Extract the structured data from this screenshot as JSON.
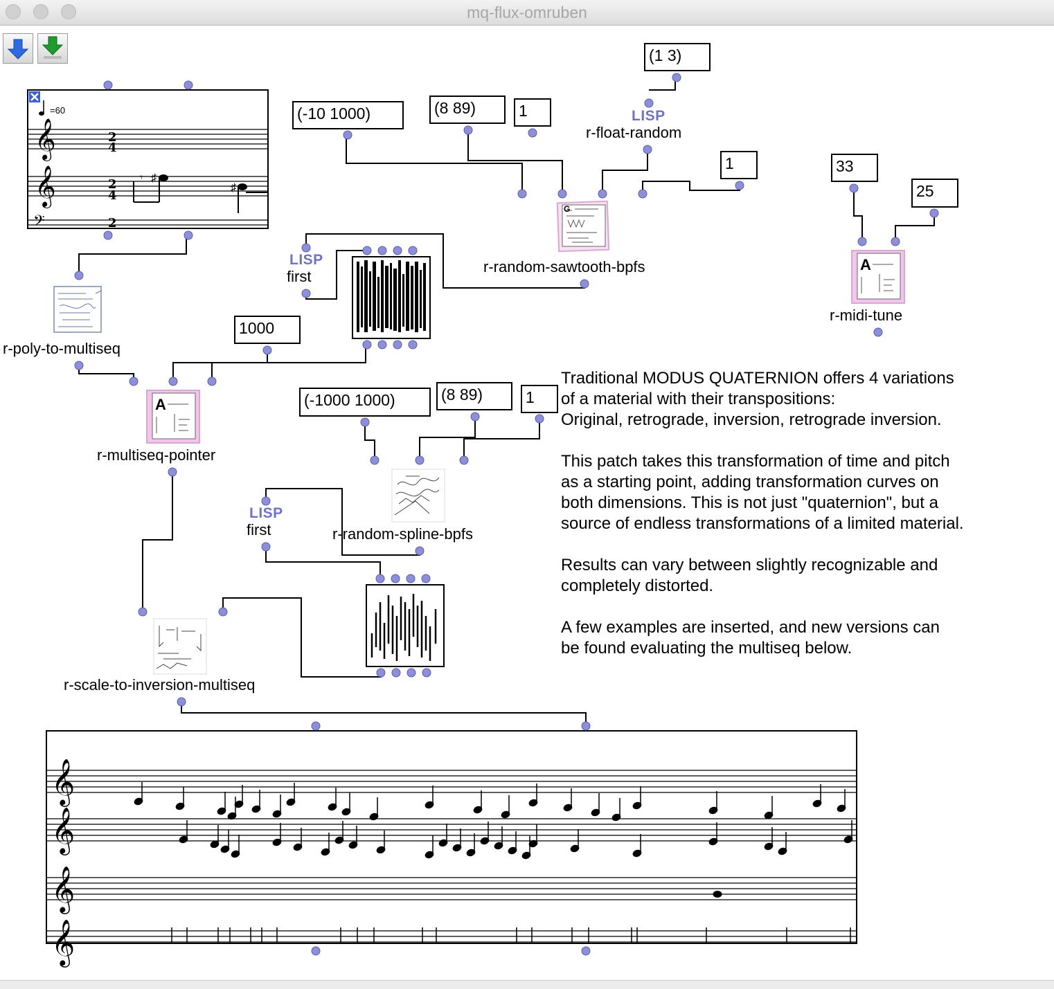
{
  "window": {
    "title": "mq-flux-omruben"
  },
  "toolbar": {
    "buttons": [
      {
        "icon": "blue-down-arrow-icon"
      },
      {
        "icon": "green-down-arrow-icon"
      }
    ]
  },
  "value_boxes": {
    "pair_1_3": "(1 3)",
    "range_10_1000": "(-10 1000)",
    "range_8_89_top": "(8 89)",
    "one_top": "1",
    "one_right": "1",
    "num_33": "33",
    "num_25": "25",
    "num_1000": "1000",
    "range_1000_1000": "(-1000 1000)",
    "range_8_89_mid": "(8 89)",
    "one_mid": "1"
  },
  "lisp_tag": "LISP",
  "labels": {
    "float_random": "r-float-random",
    "sawtooth": "r-random-sawtooth-bpfs",
    "midi_tune": "r-midi-tune",
    "poly_to_multiseq": "r-poly-to-multiseq",
    "first_1": "first",
    "multiseq_pointer": "r-multiseq-pointer",
    "first_2": "first",
    "spline": "r-random-spline-bpfs",
    "scale_inversion": "r-scale-to-inversion-multiseq"
  },
  "score": {
    "tempo": "=60",
    "time_sig": "2/4"
  },
  "comment": {
    "paragraphs": [
      "Traditional MODUS QUATERNION offers 4 variations\nof a material with their transpositions:\nOriginal, retrograde, inversion, retrograde inversion.",
      "This patch takes this transformation of time and pitch\nas a starting point, adding transformation curves on\nboth dimensions. This is not just \"quaternion\", but a\nsource of endless transformations of a limited material.",
      "Results can vary between slightly recognizable and\ncompletely distorted.",
      "A few examples are inserted, and new versions can\nbe found evaluating the multiseq below."
    ]
  },
  "colors": {
    "inlet": "#8d90d8",
    "lisp": "#6f73c8",
    "pink": "#e8b4e0"
  }
}
